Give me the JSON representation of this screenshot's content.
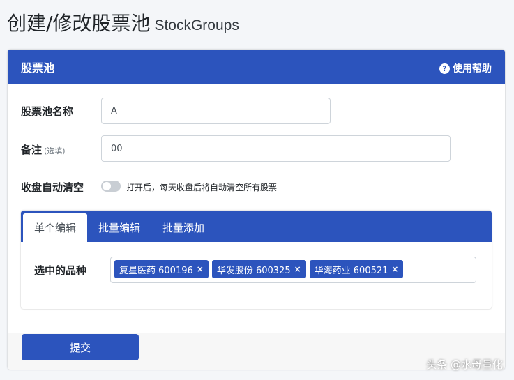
{
  "page": {
    "title": "创建/修改股票池",
    "subtitle": "StockGroups"
  },
  "card": {
    "title": "股票池",
    "help_label": "使用帮助",
    "help_icon": "question-circle-icon"
  },
  "form": {
    "name_label": "股票池名称",
    "name_value": "A",
    "note_label": "备注",
    "note_optional": "(选填)",
    "note_value": "00",
    "autoclear_label": "收盘自动清空",
    "autoclear_on": false,
    "autoclear_hint": "打开后，每天收盘后将自动清空所有股票"
  },
  "tabs": [
    {
      "label": "单个编辑",
      "active": true
    },
    {
      "label": "批量编辑",
      "active": false
    },
    {
      "label": "批量添加",
      "active": false
    }
  ],
  "selected": {
    "label": "选中的品种",
    "tags": [
      {
        "text": "复星医药 600196",
        "remove": "×"
      },
      {
        "text": "华发股份 600325",
        "remove": "×"
      },
      {
        "text": "华海药业 600521",
        "remove": "×"
      }
    ]
  },
  "footer": {
    "submit_label": "提交"
  },
  "watermark": "头条 @水母量化",
  "colors": {
    "primary": "#2c54bd",
    "background": "#f4f6f9"
  }
}
